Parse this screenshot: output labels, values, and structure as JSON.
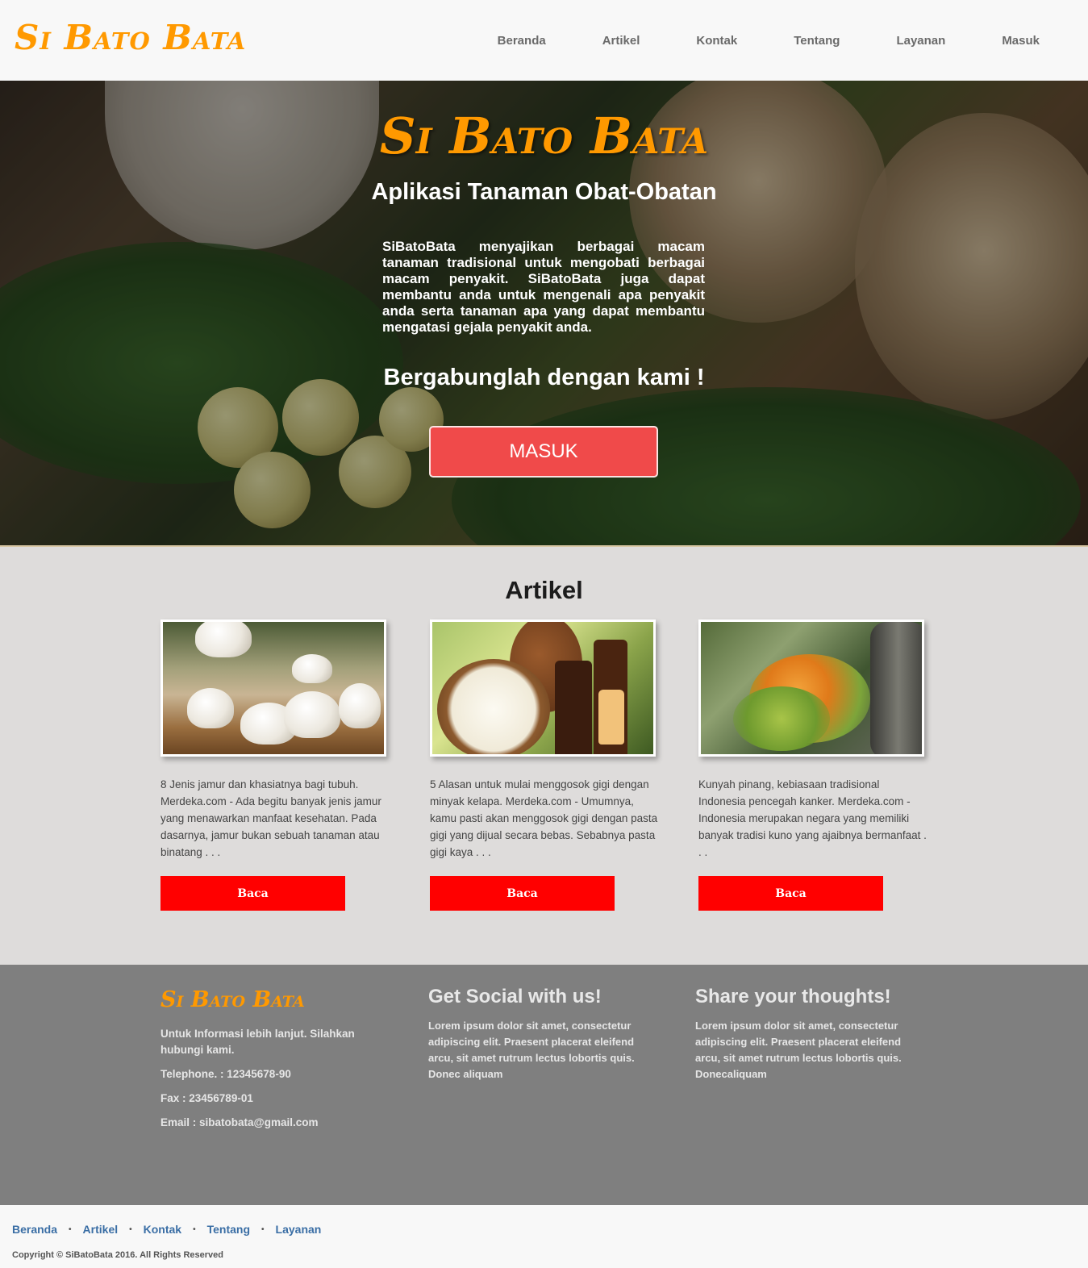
{
  "navbar": {
    "brand": "Si Bato Bata",
    "links": [
      "Beranda",
      "Artikel",
      "Kontak",
      "Tentang",
      "Layanan",
      "Masuk"
    ]
  },
  "hero": {
    "title": "Si Bato Bata",
    "subtitle": "Aplikasi Tanaman Obat-Obatan",
    "description": "SiBatoBata menyajikan berbagai macam tanaman tradisional untuk mengobati berbagai macam penyakit. SiBatoBata juga dapat membantu anda untuk mengenali apa penyakit anda serta tanaman apa yang dapat membantu mengatasi gejala penyakit anda.",
    "cta_text": "Bergabunglah dengan kami !",
    "button_label": "MASUK"
  },
  "articles": {
    "title": "Artikel",
    "items": [
      {
        "image": "mushrooms-image",
        "text": "8 Jenis jamur dan khasiatnya bagi tubuh. Merdeka.com - Ada begitu banyak jenis jamur yang menawarkan manfaat kesehatan. Pada dasarnya, jamur bukan sebuah tanaman atau binatang . . .",
        "button": "Baca"
      },
      {
        "image": "coconut-oil-image",
        "text": "5 Alasan untuk mulai menggosok gigi dengan minyak kelapa. Merdeka.com - Umumnya, kamu pasti akan menggosok gigi dengan pasta gigi yang dijual secara bebas. Sebabnya pasta gigi kaya . . .",
        "button": "Baca"
      },
      {
        "image": "betel-nut-image",
        "text": "Kunyah pinang, kebiasaan tradisional Indonesia pencegah kanker. Merdeka.com - Indonesia merupakan negara yang memiliki banyak tradisi kuno yang ajaibnya bermanfaat . . .",
        "button": "Baca"
      }
    ]
  },
  "footer": {
    "brand": "Si Bato Bata",
    "info": "Untuk Informasi lebih lanjut. Silahkan hubungi kami.",
    "telephone": "Telephone. : 12345678-90",
    "fax": "Fax : 23456789-01",
    "email": "Email : sibatobata@gmail.com",
    "social_heading": "Get Social with us!",
    "social_text": "Lorem ipsum dolor sit amet, consectetur adipiscing elit. Praesent placerat eleifend arcu, sit amet rutrum lectus lobortis quis. Donec aliquam",
    "thoughts_heading": "Share your thoughts!",
    "thoughts_text": "Lorem ipsum dolor sit amet, consectetur adipiscing elit. Praesent placerat eleifend arcu, sit amet rutrum lectus lobortis quis. Donecaliquam"
  },
  "bottombar": {
    "links": [
      "Beranda",
      "Artikel",
      "Kontak",
      "Tentang",
      "Layanan"
    ],
    "separator": "•",
    "copyright": "Copyright © SiBatoBata 2016. All Rights Reserved"
  },
  "colors": {
    "brand_orange": "#ff9900",
    "hero_button": "#f04a4a",
    "read_button": "#ff0000",
    "footer_bg": "#7f7f7f",
    "link_blue": "#3a6ea5"
  }
}
